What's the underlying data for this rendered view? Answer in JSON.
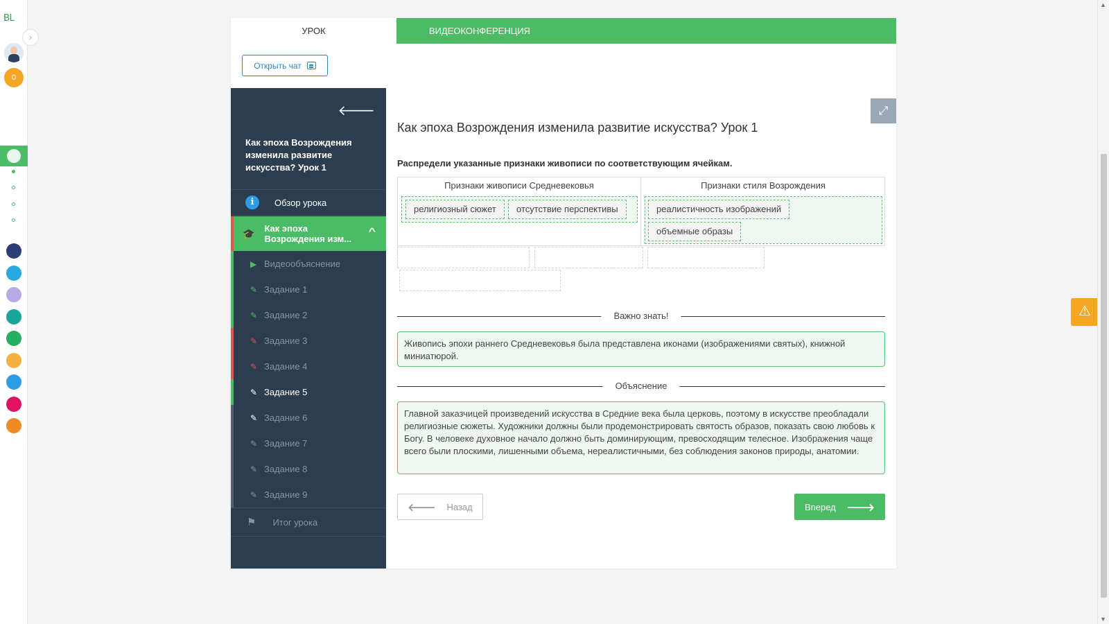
{
  "rail": {
    "logo": "BL",
    "expand_icon": "›",
    "coin_count": "0",
    "apps": [
      {
        "name": "smart-app-icon",
        "color": "#2c3e78"
      },
      {
        "name": "help-app-icon",
        "color": "#2aa8e0"
      },
      {
        "name": "keyboard-app-icon",
        "color": "#b8a9e6"
      },
      {
        "name": "teal-app-icon",
        "color": "#1aa59b"
      },
      {
        "name": "green-app-icon",
        "color": "#27ae60"
      },
      {
        "name": "orange-app-icon",
        "color": "#f5b041"
      },
      {
        "name": "check-app-icon",
        "color": "#2e9be6"
      },
      {
        "name": "pink-app-icon",
        "color": "#e0115f"
      },
      {
        "name": "bulb-app-icon",
        "color": "#f08a24"
      }
    ]
  },
  "tabs": {
    "lesson": "УРОК",
    "video_conference": "ВИДЕОКОНФЕРЕНЦИЯ"
  },
  "chat_button": "Открыть чат",
  "sidebar": {
    "lesson_title": "Как эпоха Возрождения изменила развитие искусства? Урок 1",
    "overview": "Обзор урока",
    "current_lesson": "Как эпоха Возрождения изм...",
    "items": [
      {
        "label": "Видеообъяснение",
        "icon": "play-icon",
        "status_color": "#4cbb66"
      },
      {
        "label": "Задание 1",
        "icon": "edit-icon",
        "status_color": "#4cbb66"
      },
      {
        "label": "Задание 2",
        "icon": "edit-icon",
        "status_color": "#4cbb66"
      },
      {
        "label": "Задание 3",
        "icon": "edit-icon",
        "status_color": "#e25555"
      },
      {
        "label": "Задание 4",
        "icon": "edit-icon",
        "status_color": "#e25555"
      },
      {
        "label": "Задание 5",
        "icon": "edit-icon",
        "status_color": "#4cbb66"
      },
      {
        "label": "Задание 6",
        "icon": "edit-icon",
        "status_color": "#56606c"
      },
      {
        "label": "Задание 7",
        "icon": "edit-icon",
        "status_color": "#56606c"
      },
      {
        "label": "Задание 8",
        "icon": "edit-icon",
        "status_color": "#56606c"
      },
      {
        "label": "Задание 9",
        "icon": "edit-icon",
        "status_color": "#56606c"
      }
    ],
    "summary": "Итог урока"
  },
  "content": {
    "title": "Как эпоха Возрождения изменила развитие искусства? Урок 1",
    "instruction": "Распредели указанные признаки живописи по соответствующим ячейкам.",
    "columns": [
      {
        "header": "Признаки живописи Средневековья",
        "chips": [
          "религиозный сюжет",
          "отсутствие перспективы"
        ]
      },
      {
        "header": "Признаки стиля Возрождения",
        "chips": [
          "реалистичность изображений",
          "объемные образы"
        ]
      }
    ],
    "important_label": "Важно знать!",
    "important_text": "Живопись эпохи раннего Средневековья была представлена иконами (изображениями святых), книжной миниатюрой.",
    "explanation_label": "Объяснение",
    "explanation_text": "Главной заказчицей произведений искусства в Средние века была церковь, поэтому в искусстве преобладали религиозные сюжеты. Художники должны были продемонстрировать святость образов, показать свою любовь к Богу. В человеке духовное начало должно быть доминирующим, превосходящим телесное. Изображения чаще всего были плоскими, лишенными объема, нереалистичными, без соблюдения законов природы, анатомии.",
    "back_button": "Назад",
    "forward_button": "Вперед"
  },
  "colors": {
    "accent": "#4cbb66",
    "sidebar_bg": "#2c3d50",
    "error": "#e25555",
    "warning": "#f5a623",
    "link": "#2e86c1"
  }
}
